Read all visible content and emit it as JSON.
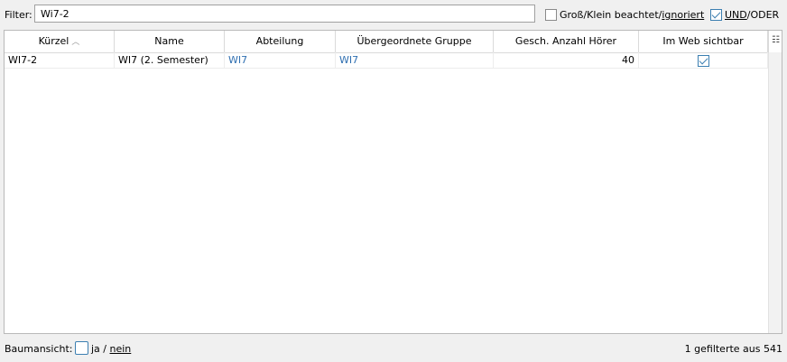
{
  "filter": {
    "label": "Filter:",
    "value": "Wi7-2",
    "case_option": {
      "prefix": "Groß/Klein beachtet/",
      "underlined": "ignoriert",
      "checked": false
    },
    "and_or_option": {
      "underlined": "UND",
      "suffix": "/ODER",
      "checked": true
    }
  },
  "table": {
    "columns": [
      "Kürzel",
      "Name",
      "Abteilung",
      "Übergeordnete Gruppe",
      "Gesch. Anzahl Hörer",
      "Im Web sichtbar"
    ],
    "sorted_column": "Kürzel",
    "sort_direction": "ascending",
    "rows": [
      {
        "kuerzel": "WI7-2",
        "name": "WI7 (2. Semester)",
        "abteilung": "WI7",
        "gruppe": "WI7",
        "hoerer": "40",
        "web": true
      }
    ]
  },
  "footer": {
    "tree_label": "Baumansicht:",
    "tree_checked": false,
    "ja": "ja",
    "separator": " / ",
    "nein": "nein",
    "count_text": "1 gefilterte aus 541"
  },
  "colors": {
    "link": "#2f6fb1",
    "checkbox_accent": "#3c7fb1",
    "background": "#f0f0f0"
  }
}
